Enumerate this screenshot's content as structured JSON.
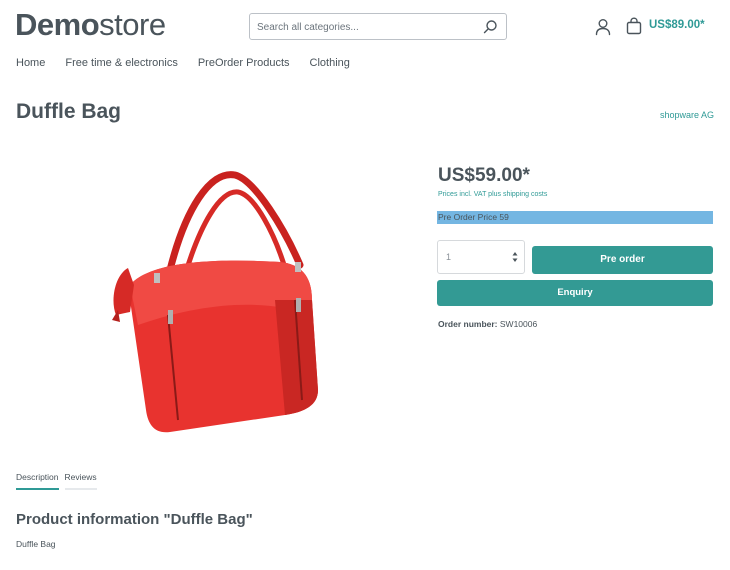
{
  "header": {
    "logo_bold": "Demo",
    "logo_light": "store",
    "search_placeholder": "Search all categories...",
    "cart_total": "US$89.00*"
  },
  "nav": {
    "items": [
      "Home",
      "Free time & electronics",
      "PreOrder Products",
      "Clothing"
    ]
  },
  "product": {
    "title": "Duffle Bag",
    "manufacturer": "shopware AG",
    "price": "US$59.00*",
    "tax_note": "Prices incl. VAT plus shipping costs",
    "preorder_price": "Pre Order Price 59",
    "quantity": "1",
    "preorder_button": "Pre order",
    "enquiry_button": "Enquiry",
    "order_number_label": "Order number:",
    "order_number_value": "SW10006"
  },
  "tabs": [
    "Description",
    "Reviews"
  ],
  "description": {
    "title": "Product information \"Duffle Bag\"",
    "text": "Duffle Bag"
  },
  "colors": {
    "accent": "#2f9a96",
    "button": "#339a94",
    "highlight": "#74b6e2",
    "bag": "#e8332f"
  }
}
